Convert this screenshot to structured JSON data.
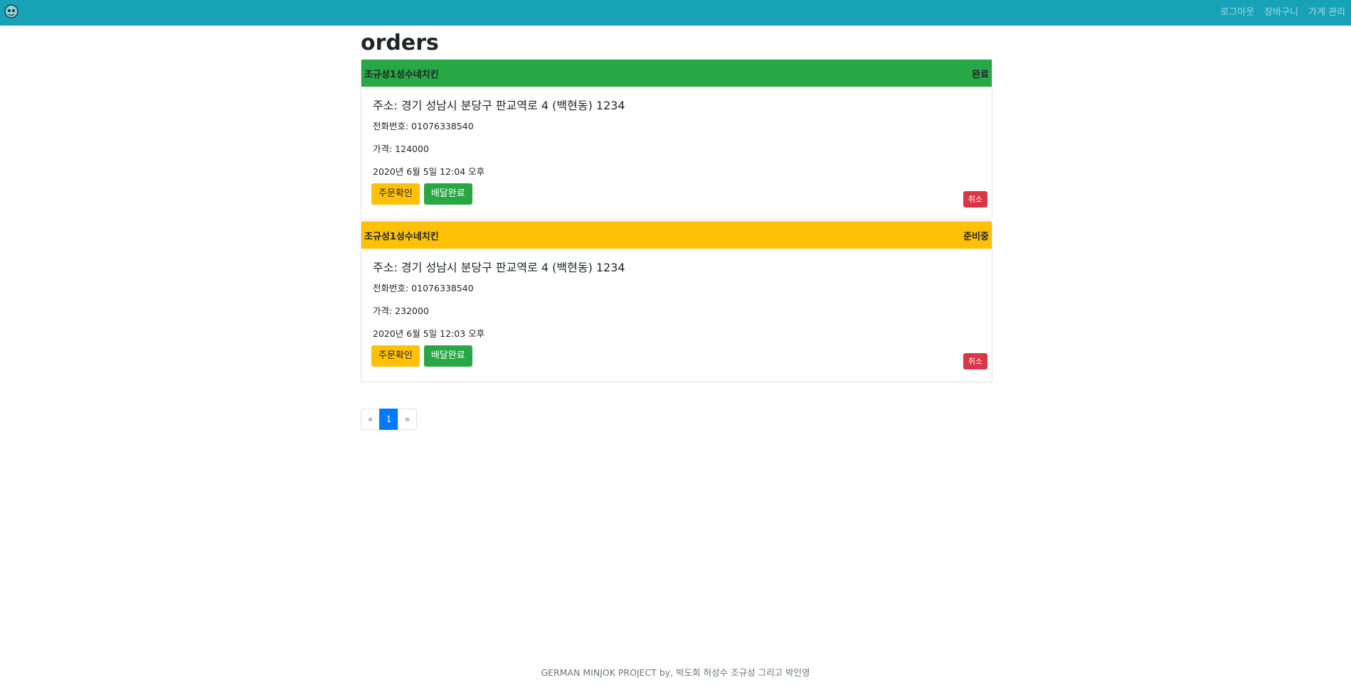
{
  "nav": {
    "logout": "로그아웃",
    "cart": "장바구니",
    "store_manage": "가게 관리"
  },
  "page": {
    "title": "orders"
  },
  "orders": [
    {
      "store": "조규성1성수네치킨",
      "status": "완료",
      "address": "주소: 경기 성남시 분당구 판교역로 4 (백현동) 1234",
      "phone": "전화번호: 01076338540",
      "price": "가격: 124000",
      "date": "2020년 6월 5일 12:04 오후",
      "confirm_label": "주문확인",
      "deliver_label": "배달완료",
      "cancel_label": "취소"
    },
    {
      "store": "조규성1성수네치킨",
      "status": "준비중",
      "address": "주소: 경기 성남시 분당구 판교역로 4 (백현동) 1234",
      "phone": "전화번호: 01076338540",
      "price": "가격: 232000",
      "date": "2020년 6월 5일 12:03 오후",
      "confirm_label": "주문확인",
      "deliver_label": "배달완료",
      "cancel_label": "취소"
    }
  ],
  "pagination": {
    "prev": "«",
    "current": "1",
    "next": "»"
  },
  "footer": {
    "text": "GERMAN MINJOK PROJECT by, 박도희 허성수 조규성 그리고 박인영"
  },
  "colors": {
    "navbar": "#17a2b8",
    "status_done": "#28a745",
    "status_prep": "#ffc107",
    "danger": "#dc3545",
    "primary": "#007bff"
  }
}
